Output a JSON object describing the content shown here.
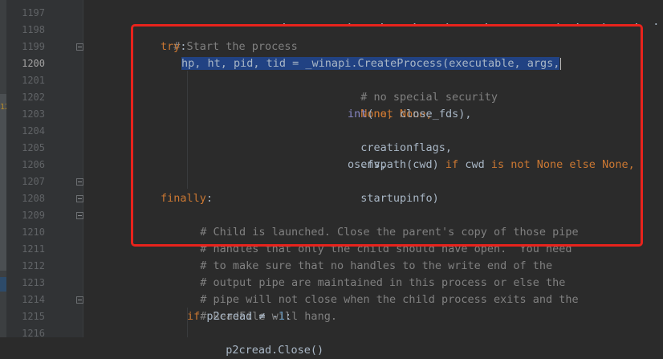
{
  "gutter": {
    "line_numbers": [
      "1197",
      "1198",
      "1199",
      "1200",
      "1201",
      "1202",
      "1203",
      "1204",
      "1205",
      "1206",
      "1207",
      "1208",
      "1209",
      "1210",
      "1211",
      "1212",
      "1213",
      "1214",
      "1215",
      "1216"
    ],
    "current_line": "1200",
    "side_marker": "1204"
  },
  "code": {
    "l0_partial": "             .         ,    .    .    ,     .          ,  .   ,    .  . ,",
    "l1": "# Start the process",
    "l2_kw": "try",
    "l2_punct": ":",
    "l3_selected": "hp, ht, pid, tid = _winapi.CreateProcess(executable, args,",
    "l4": "# no special security",
    "l5": "None, None,",
    "l6_builtin": "int",
    "l6_open": "(",
    "l6_kw": "not",
    "l6_rest": " close_fds),",
    "l7": "creationflags,",
    "l8": "env,",
    "l9_a": "os.fspath(cwd) ",
    "l9_if": "if",
    "l9_b": " cwd ",
    "l9_isnot": "is not",
    "l9_sp": " ",
    "l9_none1": "None",
    "l9_sp2": " ",
    "l9_else": "else",
    "l9_sp3": " ",
    "l9_none2": "None",
    "l9_comma": ",",
    "l10": "startupinfo)",
    "l11_kw": "finally",
    "l11_punct": ":",
    "l12": "# Child is launched. Close the parent's copy of those pipe",
    "l13": "# handles that only the child should have open.  You need",
    "l14": "# to make sure that no handles to the write end of the",
    "l15": "# output pipe are maintained in this process or else the",
    "l16": "# pipe will not close when the child process exits and the",
    "l17": "# ReadFile will hang.",
    "l18_if": "if",
    "l18_a": " p2cread ",
    "l18_op": "≠",
    "l18_b": " -",
    "l18_num": "1",
    "l18_colon": ":",
    "l19": "p2cread.Close()"
  },
  "colors": {
    "background": "#2b2b2b",
    "gutter": "#313335",
    "keyword": "#cc7832",
    "comment": "#808080",
    "builtin": "#8888c6",
    "number": "#6897bb",
    "selection": "#214283",
    "highlight_box": "#e8231c"
  }
}
